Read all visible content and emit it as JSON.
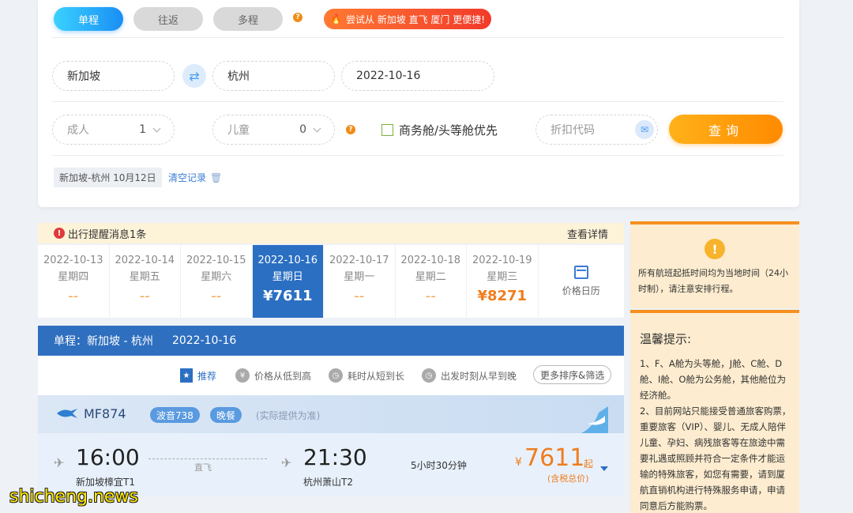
{
  "search": {
    "trip_types": [
      "单程",
      "往返",
      "多程"
    ],
    "promo": "尝试从 新加坡 直飞 厦门 更便捷!",
    "from": "新加坡",
    "to": "杭州",
    "date": "2022-10-16",
    "adult_label": "成人",
    "adult_count": "1",
    "child_label": "儿童",
    "child_count": "0",
    "business_label": "商务舱/头等舱优先",
    "coupon_placeholder": "折扣代码",
    "search_button": "查询",
    "history_item": "新加坡-杭州 10月12日",
    "clear_history": "清空记录"
  },
  "alert": {
    "message": "出行提醒消息1条",
    "detail_link": "查看详情"
  },
  "dates": [
    {
      "date": "2022-10-13",
      "weekday": "星期四",
      "price": "--"
    },
    {
      "date": "2022-10-14",
      "weekday": "星期五",
      "price": "--"
    },
    {
      "date": "2022-10-15",
      "weekday": "星期六",
      "price": "--"
    },
    {
      "date": "2022-10-16",
      "weekday": "星期日",
      "price": "¥7611"
    },
    {
      "date": "2022-10-17",
      "weekday": "星期一",
      "price": "--"
    },
    {
      "date": "2022-10-18",
      "weekday": "星期二",
      "price": "--"
    },
    {
      "date": "2022-10-19",
      "weekday": "星期三",
      "price": "¥8271"
    }
  ],
  "calendar_label": "价格日历",
  "route": {
    "title": "单程：新加坡 - 杭州",
    "date": "2022-10-16"
  },
  "sort": {
    "recommend": "推荐",
    "price": "价格从低到高",
    "duration": "耗时从短到长",
    "departure": "出发时刻从早到晚",
    "more": "更多排序&筛选"
  },
  "flight": {
    "number": "MF874",
    "aircraft": "波音738",
    "meal": "晚餐",
    "meal_note": "(实际提供为准)",
    "dep_time": "16:00",
    "dep_airport": "新加坡樟宜T1",
    "direct": "直飞",
    "arr_time": "21:30",
    "arr_airport": "杭州萧山T2",
    "duration": "5小时30分钟",
    "currency": "¥",
    "price": "7611",
    "price_from": "起",
    "tax_note": "(含税总价)"
  },
  "side": {
    "notice": "所有航班起抵时间均为当地时间（24小时制），请注意安排行程。",
    "tips_title": "温馨提示:",
    "tips_body_1": "1、F、A舱为头等舱，J舱、C舱、D舱、I舱、O舱为公务舱，其他舱位为经济舱。",
    "tips_body_2": "2、目前网站只能接受普通旅客购票，重要旅客（VIP）、婴儿、无成人陪伴儿童、孕妇、病残旅客等在旅途中需要礼遇或照顾并符合一定条件才能运输的特殊旅客，如您有需要，请到厦航直销机构进行特殊服务申请，申请同意后方能购票。"
  },
  "watermark": "shicheng.news",
  "colors": {
    "primary_blue": "#2b6fc2",
    "accent_orange": "#f07d1e",
    "search_orange": "#ff8a00"
  }
}
